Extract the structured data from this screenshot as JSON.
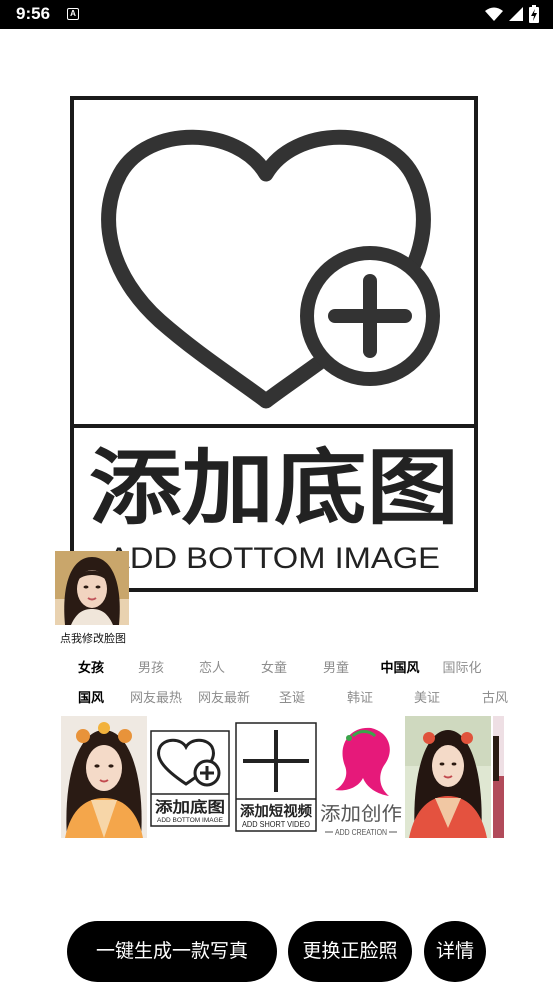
{
  "status_bar": {
    "time": "9:56",
    "notif_glyph": "A",
    "icons": [
      "wifi-icon",
      "signal-icon",
      "battery-charging-icon"
    ]
  },
  "preview": {
    "title_cn": "添加底图",
    "title_en": "ADD BOTTOM IMAGE",
    "icon": "heart-plus-icon"
  },
  "face": {
    "caption": "点我修改脸图"
  },
  "category_tabs": [
    "女孩",
    "男孩",
    "恋人",
    "女童",
    "男童",
    "中国风",
    "国际化"
  ],
  "category_active": "中国风",
  "style_tabs": [
    "国风",
    "网友最热",
    "网友最新",
    "圣诞",
    "韩证",
    "美证",
    "古风"
  ],
  "style_active": "国风",
  "templates": [
    {
      "type": "photo"
    },
    {
      "type": "add",
      "cn": "添加底图",
      "en": "ADD BOTTOM IMAGE"
    },
    {
      "type": "add",
      "cn": "添加短视频",
      "en": "ADD SHORT VIDEO"
    },
    {
      "type": "add",
      "cn": "添加创作",
      "en": "ADD CREATION"
    },
    {
      "type": "photo"
    },
    {
      "type": "photo"
    }
  ],
  "buttons": {
    "generate": "一键生成一款写真",
    "change_face": "更换正脸照",
    "detail": "详情"
  }
}
